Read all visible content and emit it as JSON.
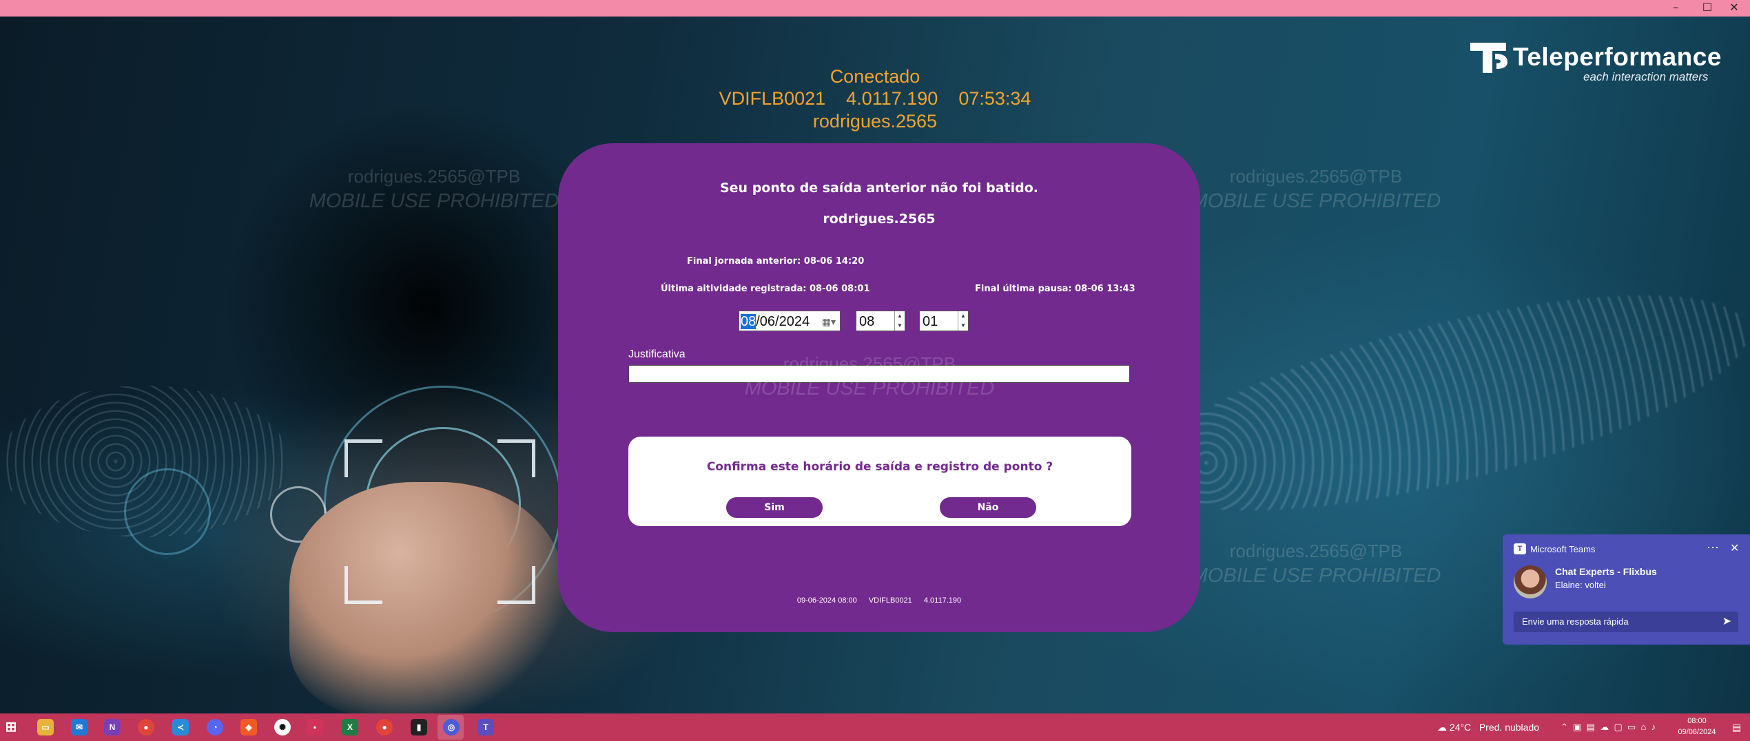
{
  "status": {
    "connection": "Conectado",
    "machine": "VDIFLB0021",
    "version": "4.0117.190",
    "time": "07:53:34",
    "user": "rodrigues.2565"
  },
  "brand": {
    "name": "Teleperformance",
    "tagline": "each interaction matters"
  },
  "watermark": {
    "line1": "rodrigues.2565@TPB",
    "line2": "MOBILE USE PROHIBITED"
  },
  "dialog": {
    "title": "Seu ponto de saída anterior não foi batido.",
    "username": "rodrigues.2565",
    "final_jornada": "Final jornada anterior: 08-06 14:20",
    "ultima_atividade": "Última aitividade registrada: 08-06 08:01",
    "final_pausa": "Final última pausa: 08-06 13:43",
    "date_day": "08",
    "date_rest": "/06/2024",
    "hour": "08",
    "minute": "01",
    "justificativa_label": "Justificativa",
    "justificativa_value": "",
    "confirm_question": "Confirma este horário de saída e registro de ponto ?",
    "yes_label": "Sim",
    "no_label": "Não",
    "footer_datetime": "09-06-2024 08:00",
    "footer_machine": "VDIFLB0021",
    "footer_version": "4.0117.190"
  },
  "teams_toast": {
    "app": "Microsoft Teams",
    "chat_name": "Chat Experts - Flixbus",
    "message": "Elaine: voltei",
    "reply_placeholder": "Envie uma resposta rápida"
  },
  "taskbar": {
    "weather_temp": "24°C",
    "weather_desc": "Pred. nublado",
    "clock_time": "08:00",
    "clock_date": "09/06/2024"
  },
  "colors": {
    "dialog_bg": "#722a8e",
    "status_text": "#f0a330",
    "taskbar": "#c0365a",
    "titlebar": "#f28aa8",
    "teams": "#4b4fb6"
  }
}
